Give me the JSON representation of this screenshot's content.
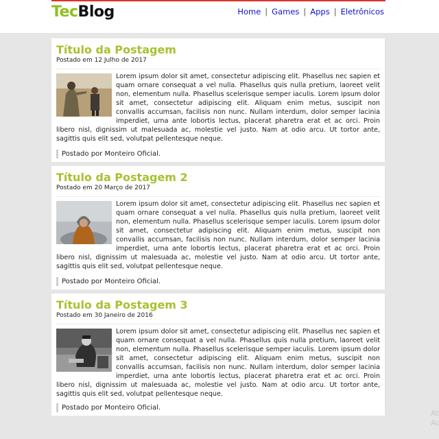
{
  "site": {
    "logo_part1": "Tec",
    "logo_part2": "Blog"
  },
  "nav": {
    "items": [
      "Home",
      "Games",
      "Apps",
      "Eletrônicos"
    ],
    "separator": "|"
  },
  "posts": [
    {
      "title": "Título da Postagem",
      "date": "Postado em 12 Julho de 2017",
      "image": "soldier-with-child-photo",
      "body": "Lorem ipsum dolor sit amet, consectetur adipiscing elit. Phasellus nec sapien et quam ornare consequat a vel nulla. Phasellus quis nulla pretium, laoreet velit non, elementum nulla. Phasellus scelerisque semper iaculis. Lorem ipsum dolor sit amet, consectetur adipiscing elit. Aliquam enim metus, suscipit non convallis accumsan, facilisis non nunc. Nullam interdum, dolor semper lacinia imperdiet, urna ante lobortis lectus, placerat pharetra erat et ac orci. Proin libero nisl, dignissim ut malesuada ac, molestie vel justo. Nam at odio arcu. Ut tortor ante, sagittis quis elit sed, volutpat pellentesque neque.",
      "footer": "Postado por Monteiro Oficial."
    },
    {
      "title": "Título da Postagem 2",
      "date": "Postado em 20 Março de 2017",
      "image": "hooded-child-photo",
      "body": "Lorem ipsum dolor sit amet, consectetur adipiscing elit. Phasellus nec sapien et quam ornare consequat a vel nulla. Phasellus quis nulla pretium, laoreet velit non, elementum nulla. Phasellus scelerisque semper iaculis. Lorem ipsum dolor sit amet, consectetur adipiscing elit. Aliquam enim metus, suscipit non convallis accumsan, facilisis non nunc. Nullam interdum, dolor semper lacinia imperdiet, urna ante lobortis lectus, placerat pharetra erat et ac orci. Proin libero nisl, dignissim ut malesuada ac, molestie vel justo. Nam at odio arcu. Ut tortor ante, sagittis quis elit sed, volutpat pellentesque neque.",
      "footer": "Postado por Monteiro Oficial."
    },
    {
      "title": "Título da Postagem 3",
      "date": "Postado em 30 Janeiro de 2016",
      "image": "elderly-man-bw-photo",
      "body": "Lorem ipsum dolor sit amet, consectetur adipiscing elit. Phasellus nec sapien et quam ornare consequat a vel nulla. Phasellus quis nulla pretium, laoreet velit non, elementum nulla. Phasellus scelerisque semper iaculis. Lorem ipsum dolor sit amet, consectetur adipiscing elit. Aliquam enim metus, suscipit non convallis accumsan, facilisis non nunc. Nullam interdum, dolor semper lacinia imperdiet, urna ante lobortis lectus, placerat pharetra erat et ac orci. Proin libero nisl, dignissim ut malesuada ac, molestie vel justo. Nam at odio arcu. Ut tortor ante, sagittis quis elit sed, volutpat pellentesque neque.",
      "footer": "Postado por Monteiro Oficial."
    }
  ],
  "watermark": "At\nAc",
  "colors": {
    "header_rule": "#e0312b",
    "logo_accent": "#8fbf1f",
    "title": "#a6c230",
    "nav_link": "#1010d0",
    "page_bg": "#e6e6e6"
  }
}
